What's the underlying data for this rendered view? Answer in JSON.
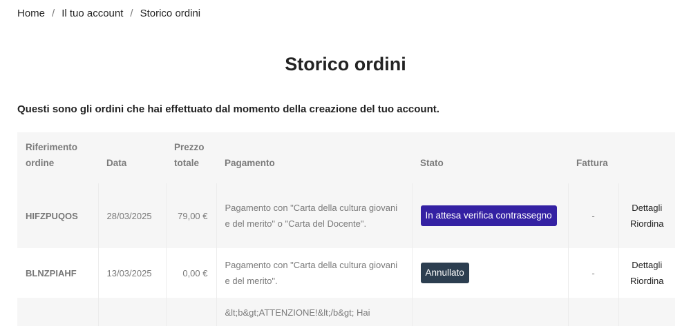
{
  "breadcrumb": [
    "Home",
    "Il tuo account",
    "Storico ordini"
  ],
  "title": "Storico ordini",
  "intro": "Questi sono gli ordini che hai effettuato dal momento della creazione del tuo account.",
  "table": {
    "headers": {
      "ref1": "Riferimento",
      "ref2": "ordine",
      "date": "Data",
      "price1": "Prezzo",
      "price2": "totale",
      "payment": "Pagamento",
      "status": "Stato",
      "invoice": "Fattura"
    },
    "rows": [
      {
        "ref": "HIFZPUQOS",
        "date": "28/03/2025",
        "price": "79,00 €",
        "payment": "Pagamento con \"Carta della cultura giovani e del merito\" o \"Carta del Docente\".",
        "status": "In attesa verifica contrassegno",
        "status_color": "#3421a3",
        "invoice": "-",
        "details": "Dettagli",
        "reorder": "Riordina"
      },
      {
        "ref": "BLNZPIAHF",
        "date": "13/03/2025",
        "price": "0,00 €",
        "payment": "Pagamento con \"Carta della cultura giovani e del merito\".",
        "status": "Annullato",
        "status_color": "#2c3e50",
        "invoice": "-",
        "details": "Dettagli",
        "reorder": "Riordina"
      },
      {
        "payment": "&lt;b&gt;ATTENZIONE!&lt;/b&gt; Hai"
      }
    ]
  }
}
